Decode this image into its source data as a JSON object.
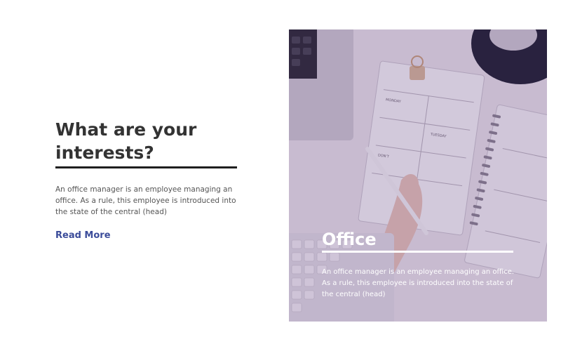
{
  "intro": {
    "heading": "What are your interests?",
    "body": "An office manager is an employee managing an office. As a rule, this employee is introduced into the state of the central (head)",
    "read_more": "Read More"
  },
  "card": {
    "title": "Office",
    "body": "An office manager is an employee managing an office. As a rule, this employee is introduced into the state of the central (head)"
  },
  "colors": {
    "heading": "#333333",
    "link": "#3b4c9a",
    "overlay": "#52287838"
  }
}
